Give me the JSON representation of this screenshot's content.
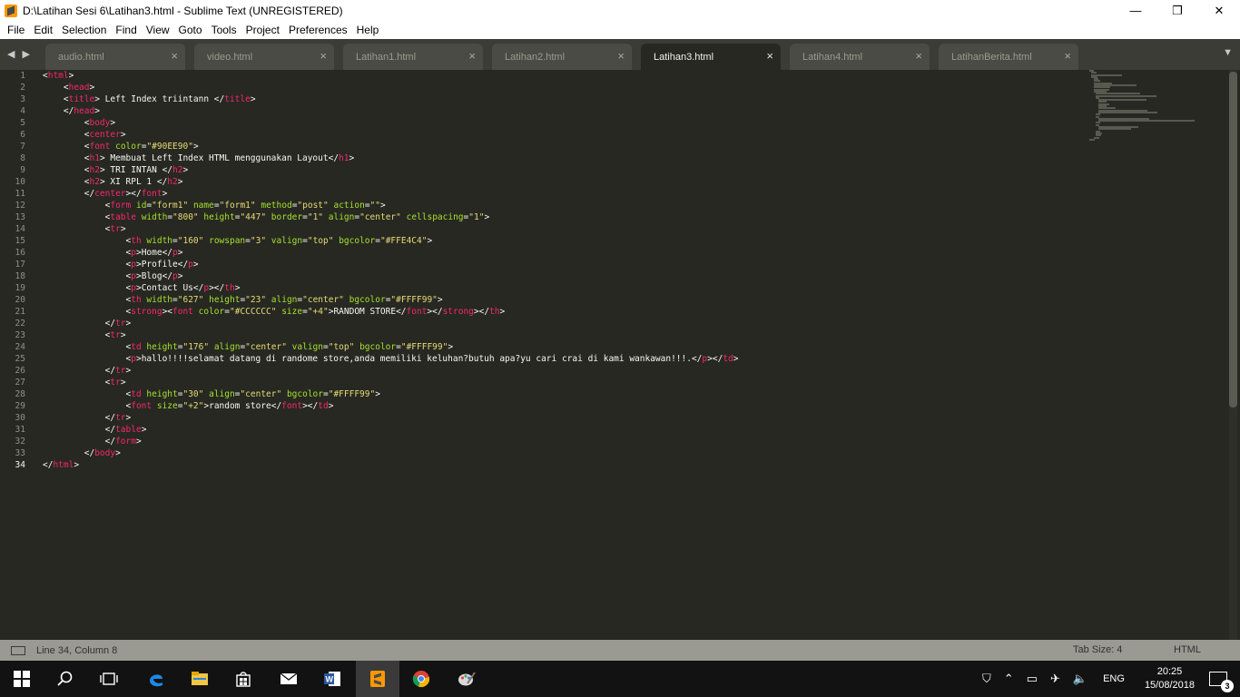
{
  "window": {
    "title": "D:\\Latihan Sesi 6\\Latihan3.html - Sublime Text (UNREGISTERED)",
    "controls": {
      "minimize": "—",
      "maximize": "❐",
      "close": "✕"
    }
  },
  "menu": [
    "File",
    "Edit",
    "Selection",
    "Find",
    "View",
    "Goto",
    "Tools",
    "Project",
    "Preferences",
    "Help"
  ],
  "tabs": [
    {
      "label": "audio.html",
      "active": false
    },
    {
      "label": "video.html",
      "active": false
    },
    {
      "label": "Latihan1.html",
      "active": false
    },
    {
      "label": "Latihan2.html",
      "active": false
    },
    {
      "label": "Latihan3.html",
      "active": true
    },
    {
      "label": "Latihan4.html",
      "active": false
    },
    {
      "label": "LatihanBerita.html",
      "active": false
    }
  ],
  "tab_close_glyph": "×",
  "nav": {
    "back": "◀",
    "forward": "▶",
    "more": "▼"
  },
  "editor": {
    "current_line": 34,
    "lines": [
      "<html>",
      "    <head>",
      "    <title> Left Index triintann </title>",
      "    </head>",
      "        <body>",
      "        <center>",
      "        <font color=\"#90EE90\">",
      "        <h1> Membuat Left Index HTML menggunakan Layout</h1>",
      "        <h2> TRI INTAN </h2>",
      "        <h2> XI RPL 1 </h2>",
      "        </center></font>",
      "            <form id=\"form1\" name=\"form1\" method=\"post\" action=\"\">",
      "            <table width=\"800\" height=\"447\" border=\"1\" align=\"center\" cellspacing=\"1\">",
      "            <tr>",
      "                <th width=\"160\" rowspan=\"3\" valign=\"top\" bgcolor=\"#FFE4C4\">",
      "                <p>Home</p>",
      "                <p>Profile</p>",
      "                <p>Blog</p>",
      "                <p>Contact Us</p></th>",
      "                <th width=\"627\" height=\"23\" align=\"center\" bgcolor=\"#FFFF99\">",
      "                <strong><font color=\"#CCCCCC\" size=\"+4\">RANDOM STORE</font></strong></th>",
      "            </tr>",
      "            <tr>",
      "                <td height=\"176\" align=\"center\" valign=\"top\" bgcolor=\"#FFFF99\">",
      "                <p>hallo!!!!selamat datang di randome store,anda memiliki keluhan?butuh apa?yu cari crai di kami wankawan!!!.</p></td>",
      "            </tr>",
      "            <tr>",
      "                <td height=\"30\" align=\"center\" bgcolor=\"#FFFF99\">",
      "                <font size=\"+2\">random store</font></td>",
      "            </tr>",
      "            </table>",
      "            </form>",
      "        </body>",
      "</html>"
    ]
  },
  "status": {
    "position": "Line 34, Column 8",
    "tab_size": "Tab Size: 4",
    "syntax": "HTML"
  },
  "taskbar": {
    "apps": [
      "start-icon",
      "search-icon",
      "task-view-icon",
      "edge-icon",
      "file-explorer-icon",
      "store-icon",
      "mail-icon",
      "word-icon",
      "sublime-text-icon",
      "chrome-icon",
      "paint-icon"
    ],
    "language": "ENG",
    "time": "20:25",
    "date": "15/08/2018",
    "notification_count": "3"
  },
  "colors": {
    "editor_bg": "#272822",
    "tag": "#f92672",
    "attribute": "#a6e22e",
    "string": "#e6db74",
    "text": "#f8f8f2"
  }
}
